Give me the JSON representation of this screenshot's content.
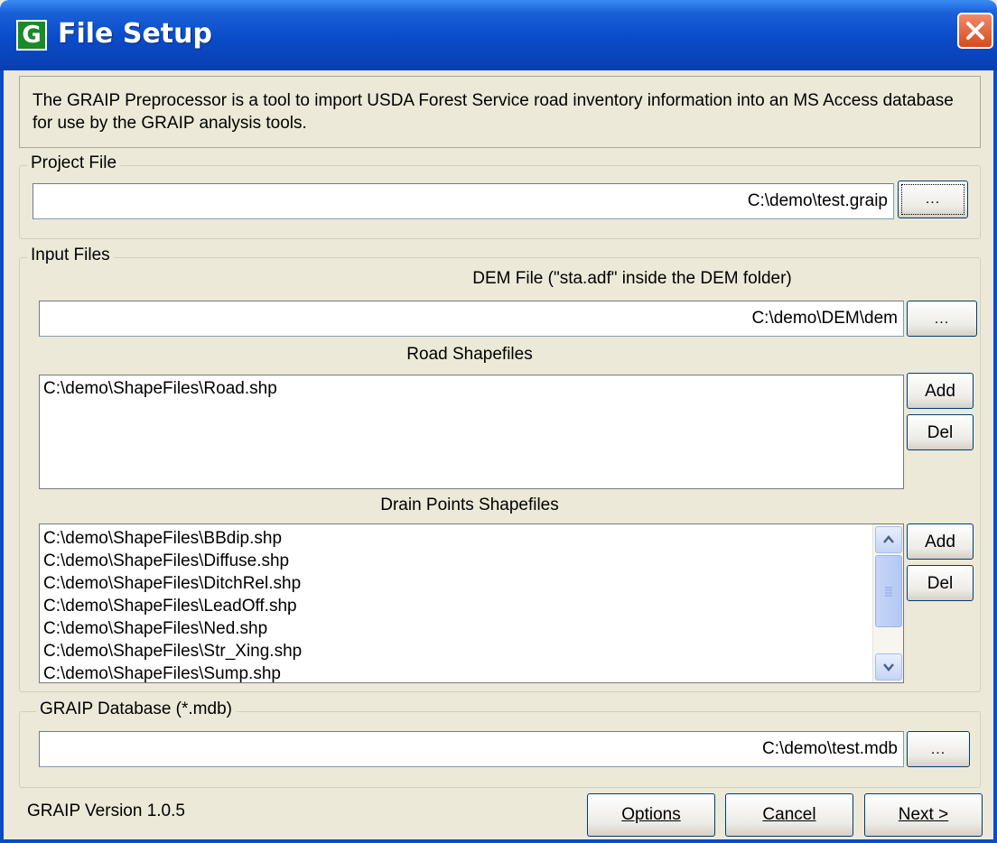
{
  "window": {
    "title": "File Setup",
    "app_icon_letter": "G"
  },
  "description": "The GRAIP Preprocessor is a tool to import USDA Forest Service road inventory information into an MS Access database for use by the GRAIP analysis tools.",
  "project_file": {
    "label": "Project File",
    "value": "C:\\demo\\test.graip",
    "browse_label": "..."
  },
  "input_files": {
    "label": "Input Files",
    "dem": {
      "label": "DEM File (\"sta.adf\" inside the DEM folder)",
      "value": "C:\\demo\\DEM\\dem",
      "browse_label": "..."
    },
    "road": {
      "label": "Road Shapefiles",
      "items": [
        "C:\\demo\\ShapeFiles\\Road.shp"
      ],
      "add_label": "Add",
      "del_label": "Del"
    },
    "drain": {
      "label": "Drain Points Shapefiles",
      "items": [
        "C:\\demo\\ShapeFiles\\BBdip.shp",
        "C:\\demo\\ShapeFiles\\Diffuse.shp",
        "C:\\demo\\ShapeFiles\\DitchRel.shp",
        "C:\\demo\\ShapeFiles\\LeadOff.shp",
        "C:\\demo\\ShapeFiles\\Ned.shp",
        "C:\\demo\\ShapeFiles\\Str_Xing.shp",
        "C:\\demo\\ShapeFiles\\Sump.shp"
      ],
      "add_label": "Add",
      "del_label": "Del"
    }
  },
  "database": {
    "label": "GRAIP Database (*.mdb)",
    "value": "C:\\demo\\test.mdb",
    "browse_label": "..."
  },
  "footer": {
    "version": "GRAIP Version 1.0.5",
    "options_label": "Options",
    "cancel_label": "Cancel",
    "next_label": "Next >"
  },
  "icons": {
    "close": "close-icon",
    "scroll_up": "chevron-up-icon",
    "scroll_down": "chevron-down-icon"
  }
}
